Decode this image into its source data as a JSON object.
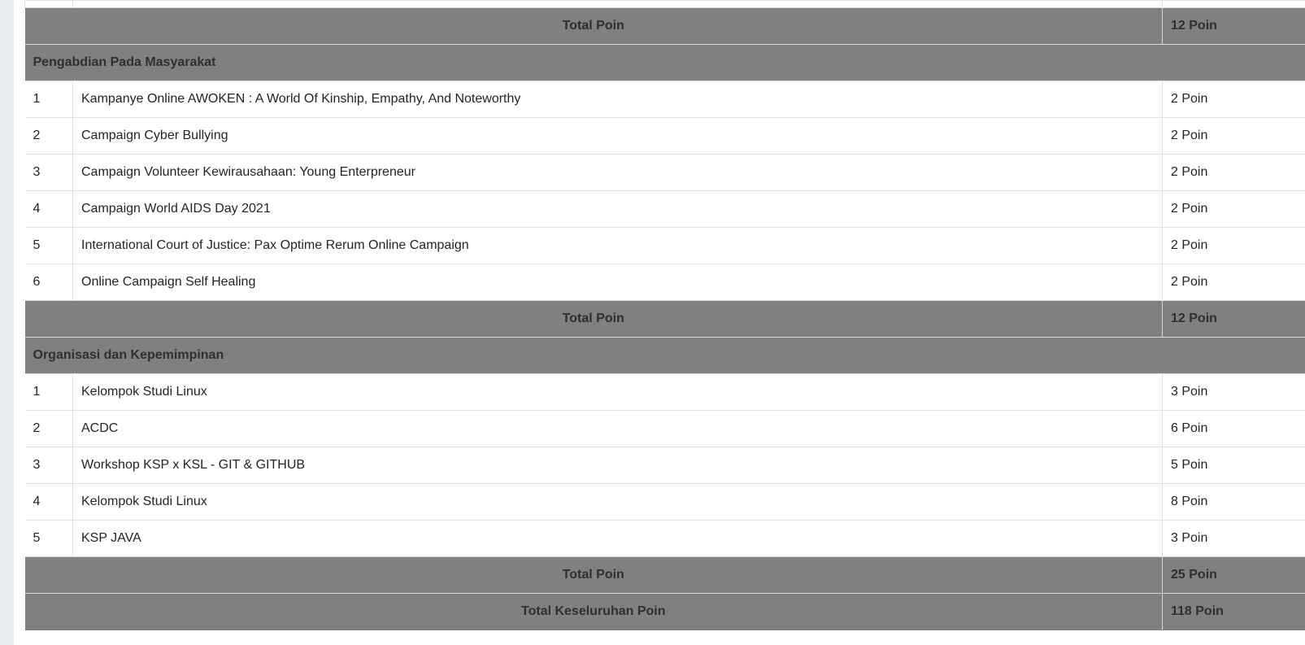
{
  "sections": [
    {
      "total_label": "Total Poin",
      "total_value": "12 Poin"
    }
  ],
  "pengabdian": {
    "title": "Pengabdian Pada Masyarakat",
    "rows": [
      {
        "no": "1",
        "name": "Kampanye Online AWOKEN : A World Of Kinship, Empathy, And Noteworthy",
        "poin": "2 Poin"
      },
      {
        "no": "2",
        "name": "Campaign Cyber Bullying",
        "poin": "2 Poin"
      },
      {
        "no": "3",
        "name": "Campaign Volunteer Kewirausahaan: Young Enterpreneur",
        "poin": "2 Poin"
      },
      {
        "no": "4",
        "name": "Campaign World AIDS Day 2021",
        "poin": "2 Poin"
      },
      {
        "no": "5",
        "name": "International Court of Justice: Pax Optime Rerum Online Campaign",
        "poin": "2 Poin"
      },
      {
        "no": "6",
        "name": "Online Campaign Self Healing",
        "poin": "2 Poin"
      }
    ],
    "total_label": "Total Poin",
    "total_value": "12 Poin"
  },
  "organisasi": {
    "title": "Organisasi dan Kepemimpinan",
    "rows": [
      {
        "no": "1",
        "name": "Kelompok Studi Linux",
        "poin": "3 Poin"
      },
      {
        "no": "2",
        "name": "ACDC",
        "poin": "6 Poin"
      },
      {
        "no": "3",
        "name": "Workshop KSP x KSL - GIT & GITHUB",
        "poin": "5 Poin"
      },
      {
        "no": "4",
        "name": "Kelompok Studi Linux",
        "poin": "8 Poin"
      },
      {
        "no": "5",
        "name": "KSP JAVA",
        "poin": "3 Poin"
      }
    ],
    "total_label": "Total Poin",
    "total_value": "25 Poin"
  },
  "grand_total": {
    "label": "Total Keseluruhan Poin",
    "value": "118 Poin"
  },
  "colors": {
    "header_bg": "#808080",
    "header_text": "#2f2f2f",
    "row_border": "#dee2e6",
    "gutter": "#e9ecef"
  }
}
